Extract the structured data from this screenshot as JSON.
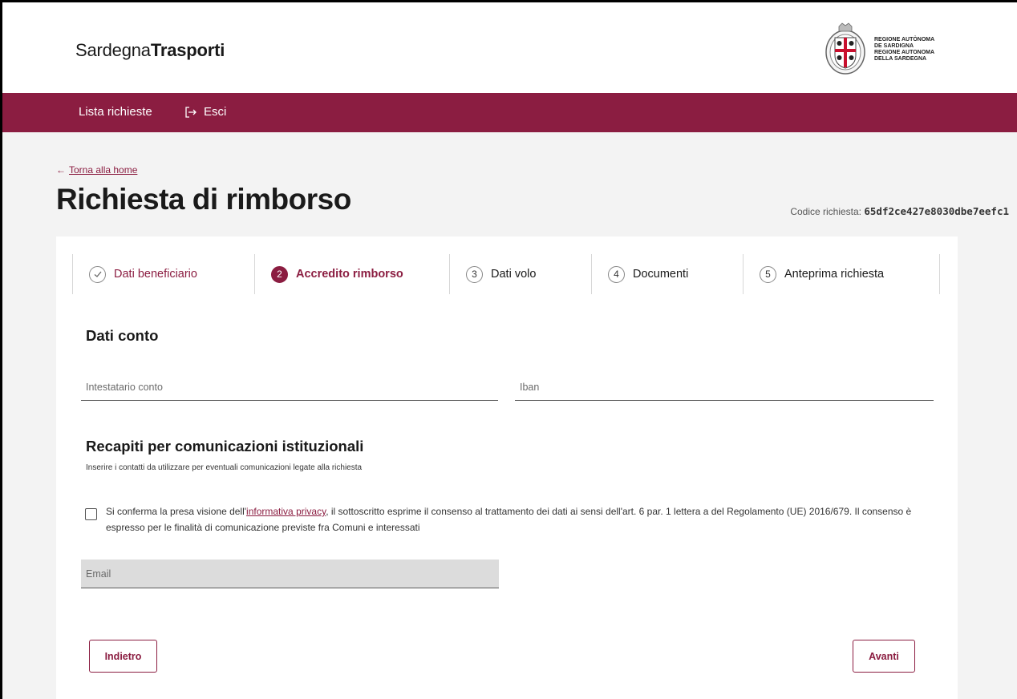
{
  "header": {
    "brand_regular": "Sardegna",
    "brand_bold": "Trasporti",
    "region_lines": [
      "Regione Autònoma",
      "de Sardigna",
      "Regione Autonoma",
      "della Sardegna"
    ]
  },
  "nav": {
    "items": [
      {
        "label": "Lista richieste",
        "icon": null
      },
      {
        "label": "Esci",
        "icon": "exit-icon"
      }
    ]
  },
  "page": {
    "back_label": "Torna alla home",
    "title": "Richiesta di rimborso",
    "code_label": "Codice richiesta:",
    "code_value": "65df2ce427e8030dbe7eefc1"
  },
  "steps": [
    {
      "num": "✓",
      "label": "Dati beneficiario",
      "state": "done"
    },
    {
      "num": "2",
      "label": "Accredito rimborso",
      "state": "active"
    },
    {
      "num": "3",
      "label": "Dati volo",
      "state": "todo"
    },
    {
      "num": "4",
      "label": "Documenti",
      "state": "todo"
    },
    {
      "num": "5",
      "label": "Anteprima richiesta",
      "state": "todo"
    }
  ],
  "form": {
    "account_section_title": "Dati conto",
    "holder_placeholder": "Intestatario conto",
    "iban_placeholder": "Iban",
    "contacts_title": "Recapiti per comunicazioni istituzionali",
    "contacts_subtitle": "Inserire i contatti da utilizzare per eventuali comunicazioni legate alla richiesta",
    "consent_prefix": "Si conferma la presa visione dell'",
    "consent_link": "informativa privacy",
    "consent_suffix": ", il sottoscritto esprime il consenso al trattamento dei dati ai sensi dell'art. 6 par. 1 lettera a del Regolamento (UE) 2016/679. Il consenso è espresso per le finalità di comunicazione previste fra Comuni e interessati",
    "email_placeholder": "Email",
    "back_button": "Indietro",
    "next_button": "Avanti"
  },
  "colors": {
    "accent": "#8b1d41",
    "background": "#f3f3f3",
    "disabled_field": "#dcdcdc"
  }
}
